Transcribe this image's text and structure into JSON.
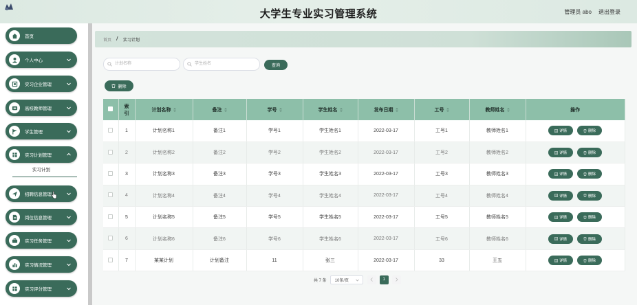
{
  "header": {
    "title": "大学生专业实习管理系统",
    "user": "管理员 abo",
    "logout": "退出登录"
  },
  "sidebar": {
    "items": [
      {
        "label": "首页",
        "icon": "home-icon",
        "chevron": false
      },
      {
        "label": "个人中心",
        "icon": "user-icon",
        "chevron": true
      },
      {
        "label": "实习企业管理",
        "icon": "building-icon",
        "chevron": true
      },
      {
        "label": "高校教师管理",
        "icon": "teacher-icon",
        "chevron": true
      },
      {
        "label": "学生管理",
        "icon": "flag-icon",
        "chevron": true
      },
      {
        "label": "实习计划管理",
        "icon": "grid-icon",
        "chevron": true
      },
      {
        "label": "招聘信息管理",
        "icon": "send-icon",
        "chevron": true
      },
      {
        "label": "岗位信息管理",
        "icon": "document-icon",
        "chevron": true
      },
      {
        "label": "实习任务管理",
        "icon": "briefcase-icon",
        "chevron": true
      },
      {
        "label": "实习情况管理",
        "icon": "chart-icon",
        "chevron": true
      },
      {
        "label": "实习评分管理",
        "icon": "grid-icon",
        "chevron": true
      }
    ],
    "submenu_label": "实习计划"
  },
  "breadcrumb": {
    "home": "首页",
    "separator": "/",
    "current": "实习计划"
  },
  "search": {
    "plan_placeholder": "计划名称",
    "student_placeholder": "学生姓名",
    "query_label": "查询",
    "delete_label": "删除"
  },
  "table": {
    "headers": [
      "索引",
      "计划名称",
      "备注",
      "学号",
      "学生姓名",
      "发布日期",
      "工号",
      "教师姓名",
      "操作"
    ],
    "index_header_line1": "索",
    "index_header_line2": "引",
    "detail_label": "详情",
    "delete_label": "删除",
    "rows": [
      {
        "index": "1",
        "plan": "计划名称1",
        "note": "备注1",
        "student_no": "学号1",
        "student_name": "学生姓名1",
        "date": "2022-03-17",
        "staff_no": "工号1",
        "teacher": "教师姓名1"
      },
      {
        "index": "2",
        "plan": "计划名称2",
        "note": "备注2",
        "student_no": "学号2",
        "student_name": "学生姓名2",
        "date": "2022-03-17",
        "staff_no": "工号2",
        "teacher": "教师姓名2"
      },
      {
        "index": "3",
        "plan": "计划名称3",
        "note": "备注3",
        "student_no": "学号3",
        "student_name": "学生姓名3",
        "date": "2022-03-17",
        "staff_no": "工号3",
        "teacher": "教师姓名3"
      },
      {
        "index": "4",
        "plan": "计划名称4",
        "note": "备注4",
        "student_no": "学号4",
        "student_name": "学生姓名4",
        "date": "2022-03-17",
        "staff_no": "工号4",
        "teacher": "教师姓名4"
      },
      {
        "index": "5",
        "plan": "计划名称5",
        "note": "备注5",
        "student_no": "学号5",
        "student_name": "学生姓名5",
        "date": "2022-03-17",
        "staff_no": "工号5",
        "teacher": "教师姓名5"
      },
      {
        "index": "6",
        "plan": "计划名称6",
        "note": "备注6",
        "student_no": "学号6",
        "student_name": "学生姓名6",
        "date": "2022-03-17",
        "staff_no": "工号6",
        "teacher": "教师姓名6"
      },
      {
        "index": "7",
        "plan": "某某计划",
        "note": "计划备注",
        "student_no": "11",
        "student_name": "张三",
        "date": "2022-03-17",
        "staff_no": "33",
        "teacher": "王五"
      }
    ]
  },
  "pagination": {
    "total": "共 7 条",
    "page_size": "10条/页",
    "current_page": "1"
  },
  "colors": {
    "accent": "#3a6b5a",
    "table_header": "#8dbfa9",
    "header_bg": "#dce9e2"
  }
}
